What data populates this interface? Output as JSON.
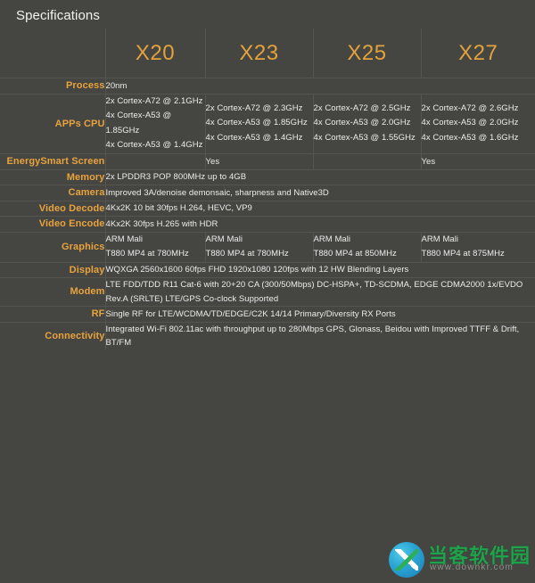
{
  "page_title": "Specifications",
  "colors": {
    "background": "#454542",
    "accent_orange": "#e8a33d",
    "model_orange": "#e2a23c",
    "text": "#ececeb",
    "gridline": "#55554f"
  },
  "table": {
    "corner_label": "",
    "columns": [
      "X20",
      "X23",
      "X25",
      "X27"
    ],
    "rows": [
      {
        "label": "Process",
        "span_all": true,
        "values": [
          "20nm"
        ]
      },
      {
        "label": "APPs CPU",
        "span_all": false,
        "values": [
          "2x Cortex-A72 @ 2.1GHz\n4x Cortex-A53 @ 1.85GHz\n4x Cortex-A53 @ 1.4GHz",
          "2x Cortex-A72 @ 2.3GHz\n4x Cortex-A53 @ 1.85GHz\n4x Cortex-A53 @ 1.4GHz",
          "2x Cortex-A72 @ 2.5GHz\n4x Cortex-A53 @ 2.0GHz\n4x Cortex-A53 @ 1.55GHz",
          "2x Cortex-A72 @ 2.6GHz\n4x Cortex-A53 @ 2.0GHz\n4x Cortex-A53 @ 1.6GHz"
        ]
      },
      {
        "label": "EnergySmart Screen",
        "span_all": false,
        "values": [
          "",
          "Yes",
          "",
          "Yes"
        ]
      },
      {
        "label": "Memory",
        "span_all": true,
        "values": [
          "2x LPDDR3 POP 800MHz up to 4GB"
        ]
      },
      {
        "label": "Camera",
        "span_all": true,
        "values": [
          "Improved 3A/denoise demonsaic, sharpness and Native3D"
        ]
      },
      {
        "label": "Video Decode",
        "span_all": true,
        "values": [
          "4Kx2K 10 bit 30fps H.264, HEVC, VP9"
        ]
      },
      {
        "label": "Video Encode",
        "span_all": true,
        "values": [
          "4Kx2K 30fps H.265 with HDR"
        ]
      },
      {
        "label": "Graphics",
        "span_all": false,
        "values": [
          "ARM Mali\nT880 MP4 at 780MHz",
          "ARM Mali\nT880 MP4 at 780MHz",
          "ARM Mali\nT880 MP4 at 850MHz",
          "ARM Mali\nT880 MP4 at 875MHz"
        ]
      },
      {
        "label": "Display",
        "span_all": true,
        "values": [
          "WQXGA 2560x1600 60fps FHD 1920x1080 120fps with 12 HW Blending Layers"
        ]
      },
      {
        "label": "Modem",
        "span_all": true,
        "values": [
          "LTE FDD/TDD R11 Cat-6 with 20+20 CA (300/50Mbps) DC-HSPA+,  TD-SCDMA, EDGE CDMA2000 1x/EVDO Rev.A (SRLTE) LTE/GPS Co-clock Supported"
        ]
      },
      {
        "label": "RF",
        "span_all": true,
        "values": [
          "Single RF for LTE/WCDMA/TD/EDGE/C2K 14/14 Primary/Diversity RX Ports"
        ]
      },
      {
        "label": "Connectivity",
        "span_all": true,
        "values": [
          "Integrated Wi-Fi 802.11ac with throughput up to 280Mbps GPS, Glonass, Beidou with Improved TTFF & Drift, BT/FM"
        ]
      }
    ]
  },
  "watermark": {
    "brand_cn": "当客软件园",
    "url": "www.downkr.com",
    "logo_icon": "downkr-logo-icon"
  }
}
